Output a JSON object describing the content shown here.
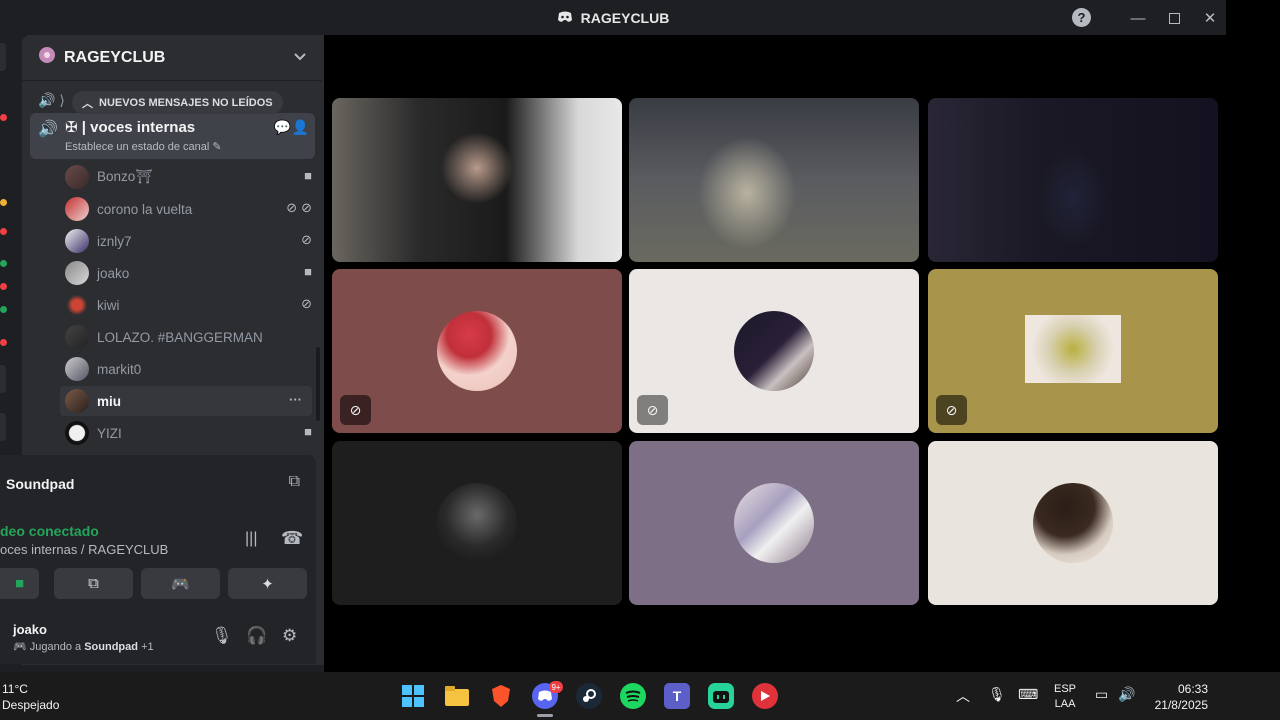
{
  "window": {
    "title": "RAGEYCLUB",
    "help": "?"
  },
  "sidebar": {
    "server_name": "RAGEYCLUB",
    "new_messages_pill": "NUEVOS MENSAJES NO LEÍDOS",
    "active_channel": {
      "name": "✠ | voces internas",
      "status": "Establece un estado de canal"
    },
    "members": [
      {
        "name": "Bonzo⛩",
        "icons": "camera"
      },
      {
        "name": "corono la vuelta",
        "icons": "mic-muted, deafened"
      },
      {
        "name": "iznly7",
        "icons": "mic-muted"
      },
      {
        "name": "joako",
        "icons": "camera"
      },
      {
        "name": "kiwi",
        "icons": "mic-muted"
      },
      {
        "name": "LOLAZO. #BANGGERMAN",
        "icons": ""
      },
      {
        "name": "markit0",
        "icons": ""
      },
      {
        "name": "miu",
        "icons": "more"
      },
      {
        "name": "YIZI",
        "icons": "camera"
      }
    ]
  },
  "soundpad": {
    "label": "Soundpad"
  },
  "voice": {
    "status": "deo conectado",
    "channel_path": "oces internas / RAGEYCLUB"
  },
  "user": {
    "name": "joako",
    "activity_prefix": "Jugando a",
    "activity_game": "Soundpad",
    "activity_extra": "+1"
  },
  "tiles": [
    {
      "kind": "camera",
      "bg": "#3a3a3a"
    },
    {
      "kind": "camera",
      "bg": "#55574f"
    },
    {
      "kind": "camera",
      "bg": "#1e1c28"
    },
    {
      "kind": "avatar",
      "bg": "#7e4d4b",
      "muted_icon": "deafened"
    },
    {
      "kind": "avatar",
      "bg": "#ebe7e4",
      "muted_icon": "mic-muted"
    },
    {
      "kind": "avatar",
      "bg": "#a8944a",
      "muted_icon": "mic-muted"
    },
    {
      "kind": "avatar",
      "bg": "#1e1e1e"
    },
    {
      "kind": "avatar",
      "bg": "#7d6f85"
    },
    {
      "kind": "avatar",
      "bg": "#e9e4de"
    }
  ],
  "taskbar": {
    "temperature": "11°C",
    "weather": "Despejado",
    "lang_top": "ESP",
    "lang_bottom": "LAA",
    "time": "06:33",
    "date": "21/8/2025",
    "discord_badge": "9+"
  }
}
